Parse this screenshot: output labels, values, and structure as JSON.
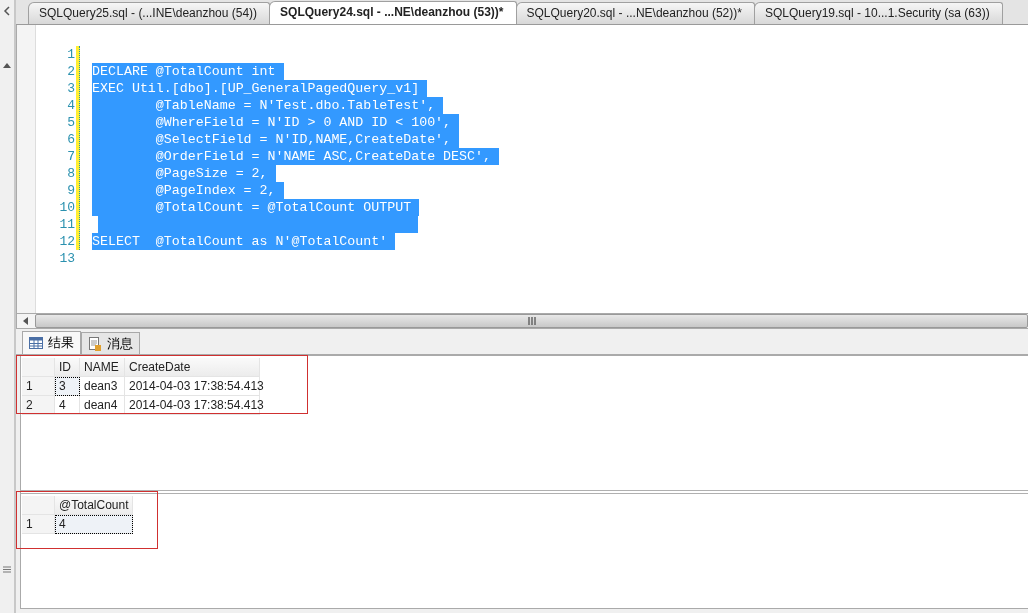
{
  "tabs": [
    {
      "label": "SQLQuery25.sql - (...INE\\deanzhou (54))",
      "selected": false
    },
    {
      "label": "SQLQuery24.sql - ...NE\\deanzhou (53))*",
      "selected": true
    },
    {
      "label": "SQLQuery20.sql - ...NE\\deanzhou (52))*",
      "selected": false
    },
    {
      "label": "SQLQuery19.sql - 10...1.Security (sa (63))",
      "selected": false
    }
  ],
  "editor": {
    "lines": [
      {
        "number": "1",
        "selected": false
      },
      {
        "number": "2",
        "text": "DECLARE @TotalCount int ",
        "selected": true
      },
      {
        "number": "3",
        "text": "EXEC Util.[dbo].[UP_GeneralPagedQuery_v1] ",
        "selected": true
      },
      {
        "number": "4",
        "text": "        @TableName = N'Test.dbo.TableTest', ",
        "selected": true
      },
      {
        "number": "5",
        "text": "        @WhereField = N'ID > 0 AND ID < 100', ",
        "selected": true
      },
      {
        "number": "6",
        "text": "        @SelectField = N'ID,NAME,CreateDate', ",
        "selected": true
      },
      {
        "number": "7",
        "text": "        @OrderField = N'NAME ASC,CreateDate DESC', ",
        "selected": true
      },
      {
        "number": "8",
        "text": "        @PageSize = 2, ",
        "selected": true
      },
      {
        "number": "9",
        "text": "        @PageIndex = 2, ",
        "selected": true
      },
      {
        "number": "10",
        "text": "        @TotalCount = @TotalCount OUTPUT ",
        "selected": true
      },
      {
        "number": "11",
        "selected": true
      },
      {
        "number": "12",
        "text": "SELECT  @TotalCount as N'@TotalCount' ",
        "selected": true
      },
      {
        "number": "13",
        "selected": false
      }
    ]
  },
  "results_tabs": [
    {
      "label": "结果",
      "kind": "grid",
      "selected": true
    },
    {
      "label": "消息",
      "kind": "messages",
      "selected": false
    }
  ],
  "result_grids": [
    {
      "annotated": true,
      "columns": [
        "ID",
        "NAME",
        "CreateDate"
      ],
      "rows": [
        {
          "number": "1",
          "focused": true,
          "cells": [
            "3",
            "dean3",
            "2014-04-03 17:38:54.413"
          ]
        },
        {
          "number": "2",
          "focused": false,
          "cells": [
            "4",
            "dean4",
            "2014-04-03 17:38:54.413"
          ]
        }
      ]
    },
    {
      "annotated": true,
      "columns": [
        "@TotalCount"
      ],
      "rows": [
        {
          "number": "1",
          "focused": true,
          "cells": [
            "4"
          ]
        }
      ]
    }
  ]
}
